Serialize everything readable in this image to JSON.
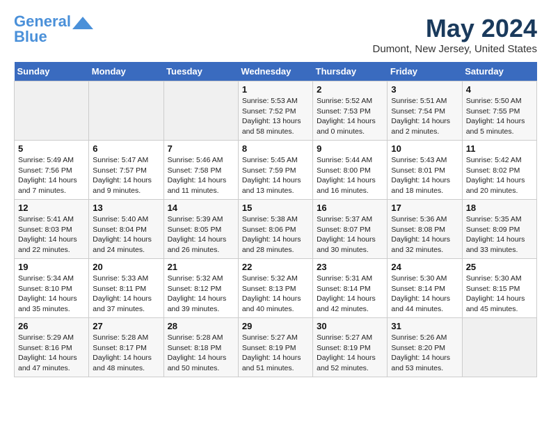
{
  "logo": {
    "line1": "General",
    "line2": "Blue"
  },
  "title": "May 2024",
  "location": "Dumont, New Jersey, United States",
  "days_of_week": [
    "Sunday",
    "Monday",
    "Tuesday",
    "Wednesday",
    "Thursday",
    "Friday",
    "Saturday"
  ],
  "weeks": [
    [
      {
        "day": "",
        "content": ""
      },
      {
        "day": "",
        "content": ""
      },
      {
        "day": "",
        "content": ""
      },
      {
        "day": "1",
        "content": "Sunrise: 5:53 AM\nSunset: 7:52 PM\nDaylight: 13 hours\nand 58 minutes."
      },
      {
        "day": "2",
        "content": "Sunrise: 5:52 AM\nSunset: 7:53 PM\nDaylight: 14 hours\nand 0 minutes."
      },
      {
        "day": "3",
        "content": "Sunrise: 5:51 AM\nSunset: 7:54 PM\nDaylight: 14 hours\nand 2 minutes."
      },
      {
        "day": "4",
        "content": "Sunrise: 5:50 AM\nSunset: 7:55 PM\nDaylight: 14 hours\nand 5 minutes."
      }
    ],
    [
      {
        "day": "5",
        "content": "Sunrise: 5:49 AM\nSunset: 7:56 PM\nDaylight: 14 hours\nand 7 minutes."
      },
      {
        "day": "6",
        "content": "Sunrise: 5:47 AM\nSunset: 7:57 PM\nDaylight: 14 hours\nand 9 minutes."
      },
      {
        "day": "7",
        "content": "Sunrise: 5:46 AM\nSunset: 7:58 PM\nDaylight: 14 hours\nand 11 minutes."
      },
      {
        "day": "8",
        "content": "Sunrise: 5:45 AM\nSunset: 7:59 PM\nDaylight: 14 hours\nand 13 minutes."
      },
      {
        "day": "9",
        "content": "Sunrise: 5:44 AM\nSunset: 8:00 PM\nDaylight: 14 hours\nand 16 minutes."
      },
      {
        "day": "10",
        "content": "Sunrise: 5:43 AM\nSunset: 8:01 PM\nDaylight: 14 hours\nand 18 minutes."
      },
      {
        "day": "11",
        "content": "Sunrise: 5:42 AM\nSunset: 8:02 PM\nDaylight: 14 hours\nand 20 minutes."
      }
    ],
    [
      {
        "day": "12",
        "content": "Sunrise: 5:41 AM\nSunset: 8:03 PM\nDaylight: 14 hours\nand 22 minutes."
      },
      {
        "day": "13",
        "content": "Sunrise: 5:40 AM\nSunset: 8:04 PM\nDaylight: 14 hours\nand 24 minutes."
      },
      {
        "day": "14",
        "content": "Sunrise: 5:39 AM\nSunset: 8:05 PM\nDaylight: 14 hours\nand 26 minutes."
      },
      {
        "day": "15",
        "content": "Sunrise: 5:38 AM\nSunset: 8:06 PM\nDaylight: 14 hours\nand 28 minutes."
      },
      {
        "day": "16",
        "content": "Sunrise: 5:37 AM\nSunset: 8:07 PM\nDaylight: 14 hours\nand 30 minutes."
      },
      {
        "day": "17",
        "content": "Sunrise: 5:36 AM\nSunset: 8:08 PM\nDaylight: 14 hours\nand 32 minutes."
      },
      {
        "day": "18",
        "content": "Sunrise: 5:35 AM\nSunset: 8:09 PM\nDaylight: 14 hours\nand 33 minutes."
      }
    ],
    [
      {
        "day": "19",
        "content": "Sunrise: 5:34 AM\nSunset: 8:10 PM\nDaylight: 14 hours\nand 35 minutes."
      },
      {
        "day": "20",
        "content": "Sunrise: 5:33 AM\nSunset: 8:11 PM\nDaylight: 14 hours\nand 37 minutes."
      },
      {
        "day": "21",
        "content": "Sunrise: 5:32 AM\nSunset: 8:12 PM\nDaylight: 14 hours\nand 39 minutes."
      },
      {
        "day": "22",
        "content": "Sunrise: 5:32 AM\nSunset: 8:13 PM\nDaylight: 14 hours\nand 40 minutes."
      },
      {
        "day": "23",
        "content": "Sunrise: 5:31 AM\nSunset: 8:14 PM\nDaylight: 14 hours\nand 42 minutes."
      },
      {
        "day": "24",
        "content": "Sunrise: 5:30 AM\nSunset: 8:14 PM\nDaylight: 14 hours\nand 44 minutes."
      },
      {
        "day": "25",
        "content": "Sunrise: 5:30 AM\nSunset: 8:15 PM\nDaylight: 14 hours\nand 45 minutes."
      }
    ],
    [
      {
        "day": "26",
        "content": "Sunrise: 5:29 AM\nSunset: 8:16 PM\nDaylight: 14 hours\nand 47 minutes."
      },
      {
        "day": "27",
        "content": "Sunrise: 5:28 AM\nSunset: 8:17 PM\nDaylight: 14 hours\nand 48 minutes."
      },
      {
        "day": "28",
        "content": "Sunrise: 5:28 AM\nSunset: 8:18 PM\nDaylight: 14 hours\nand 50 minutes."
      },
      {
        "day": "29",
        "content": "Sunrise: 5:27 AM\nSunset: 8:19 PM\nDaylight: 14 hours\nand 51 minutes."
      },
      {
        "day": "30",
        "content": "Sunrise: 5:27 AM\nSunset: 8:19 PM\nDaylight: 14 hours\nand 52 minutes."
      },
      {
        "day": "31",
        "content": "Sunrise: 5:26 AM\nSunset: 8:20 PM\nDaylight: 14 hours\nand 53 minutes."
      },
      {
        "day": "",
        "content": ""
      }
    ]
  ]
}
